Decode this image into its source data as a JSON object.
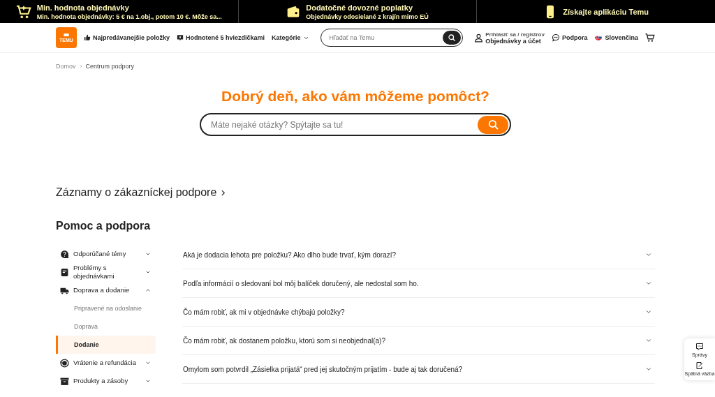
{
  "promo_bar": [
    {
      "title": "Min. hodnota objednávky",
      "text": "Min. hodnota objednávky: 5 € na 1.obj., potom 10 €. Môže sa..."
    },
    {
      "title": "Dodatočné dovozné poplatky",
      "text": "Objednávky odosielané z krajín mimo EÚ"
    },
    {
      "title": "Získajte aplikáciu Temu"
    }
  ],
  "header": {
    "logo": "TEMU",
    "nav": [
      {
        "label": "Najpredávanejšie položky"
      },
      {
        "label": "Hodnotené 5 hviezdičkami"
      },
      {
        "label": "Kategórie"
      }
    ],
    "search": {
      "placeholder": "Hľadať na Temu"
    },
    "account": {
      "line1": "Prihlásiť sa / registrov",
      "line2": "Objednávky a účet"
    },
    "support": "Podpora",
    "language": "Slovenčina"
  },
  "breadcrumb": [
    "Domov",
    "Centrum podpory"
  ],
  "hero": {
    "title": "Dobrý deň, ako vám môžeme pomôct?",
    "search_placeholder": "Máte nejaké otázky? Spýtajte sa tu!"
  },
  "records_link": "Záznamy o zákazníckej podpore",
  "help": {
    "title": "Pomoc a podpora",
    "topics": [
      {
        "label": "Odporúčané témy",
        "expanded": false
      },
      {
        "label": "Problémy s objednávkami",
        "expanded": false
      },
      {
        "label": "Doprava a dodanie",
        "expanded": true,
        "children": [
          {
            "label": "Pripravené na odoslanie",
            "selected": false
          },
          {
            "label": "Doprava",
            "selected": false
          },
          {
            "label": "Dodanie",
            "selected": true
          }
        ]
      },
      {
        "label": "Vrátenie a refundácia",
        "expanded": false
      },
      {
        "label": "Produkty a zásoby",
        "expanded": false
      }
    ],
    "questions": [
      {
        "text": "Aká je dodacia lehota pre položku? Ako dlho bude trvať, kým dorazí?",
        "expanded": false
      },
      {
        "text": "Podľa informácií o sledovaní bol môj balíček doručený, ale nedostal som ho.",
        "expanded": false
      },
      {
        "text": "Čo mám robiť, ak mi v objednávke chýbajú položky?",
        "expanded": false
      },
      {
        "text": "Čo mám robiť, ak dostanem položku, ktorú som si neobjednal(a)?",
        "expanded": false
      },
      {
        "text": "Omylom som potvrdil „Zásielka prijatá“ pred jej skutočným prijatím - bude aj tak doručená?",
        "expanded": false
      }
    ]
  },
  "floating": [
    {
      "label": "Správy"
    },
    {
      "label": "Spätná väzba"
    }
  ]
}
